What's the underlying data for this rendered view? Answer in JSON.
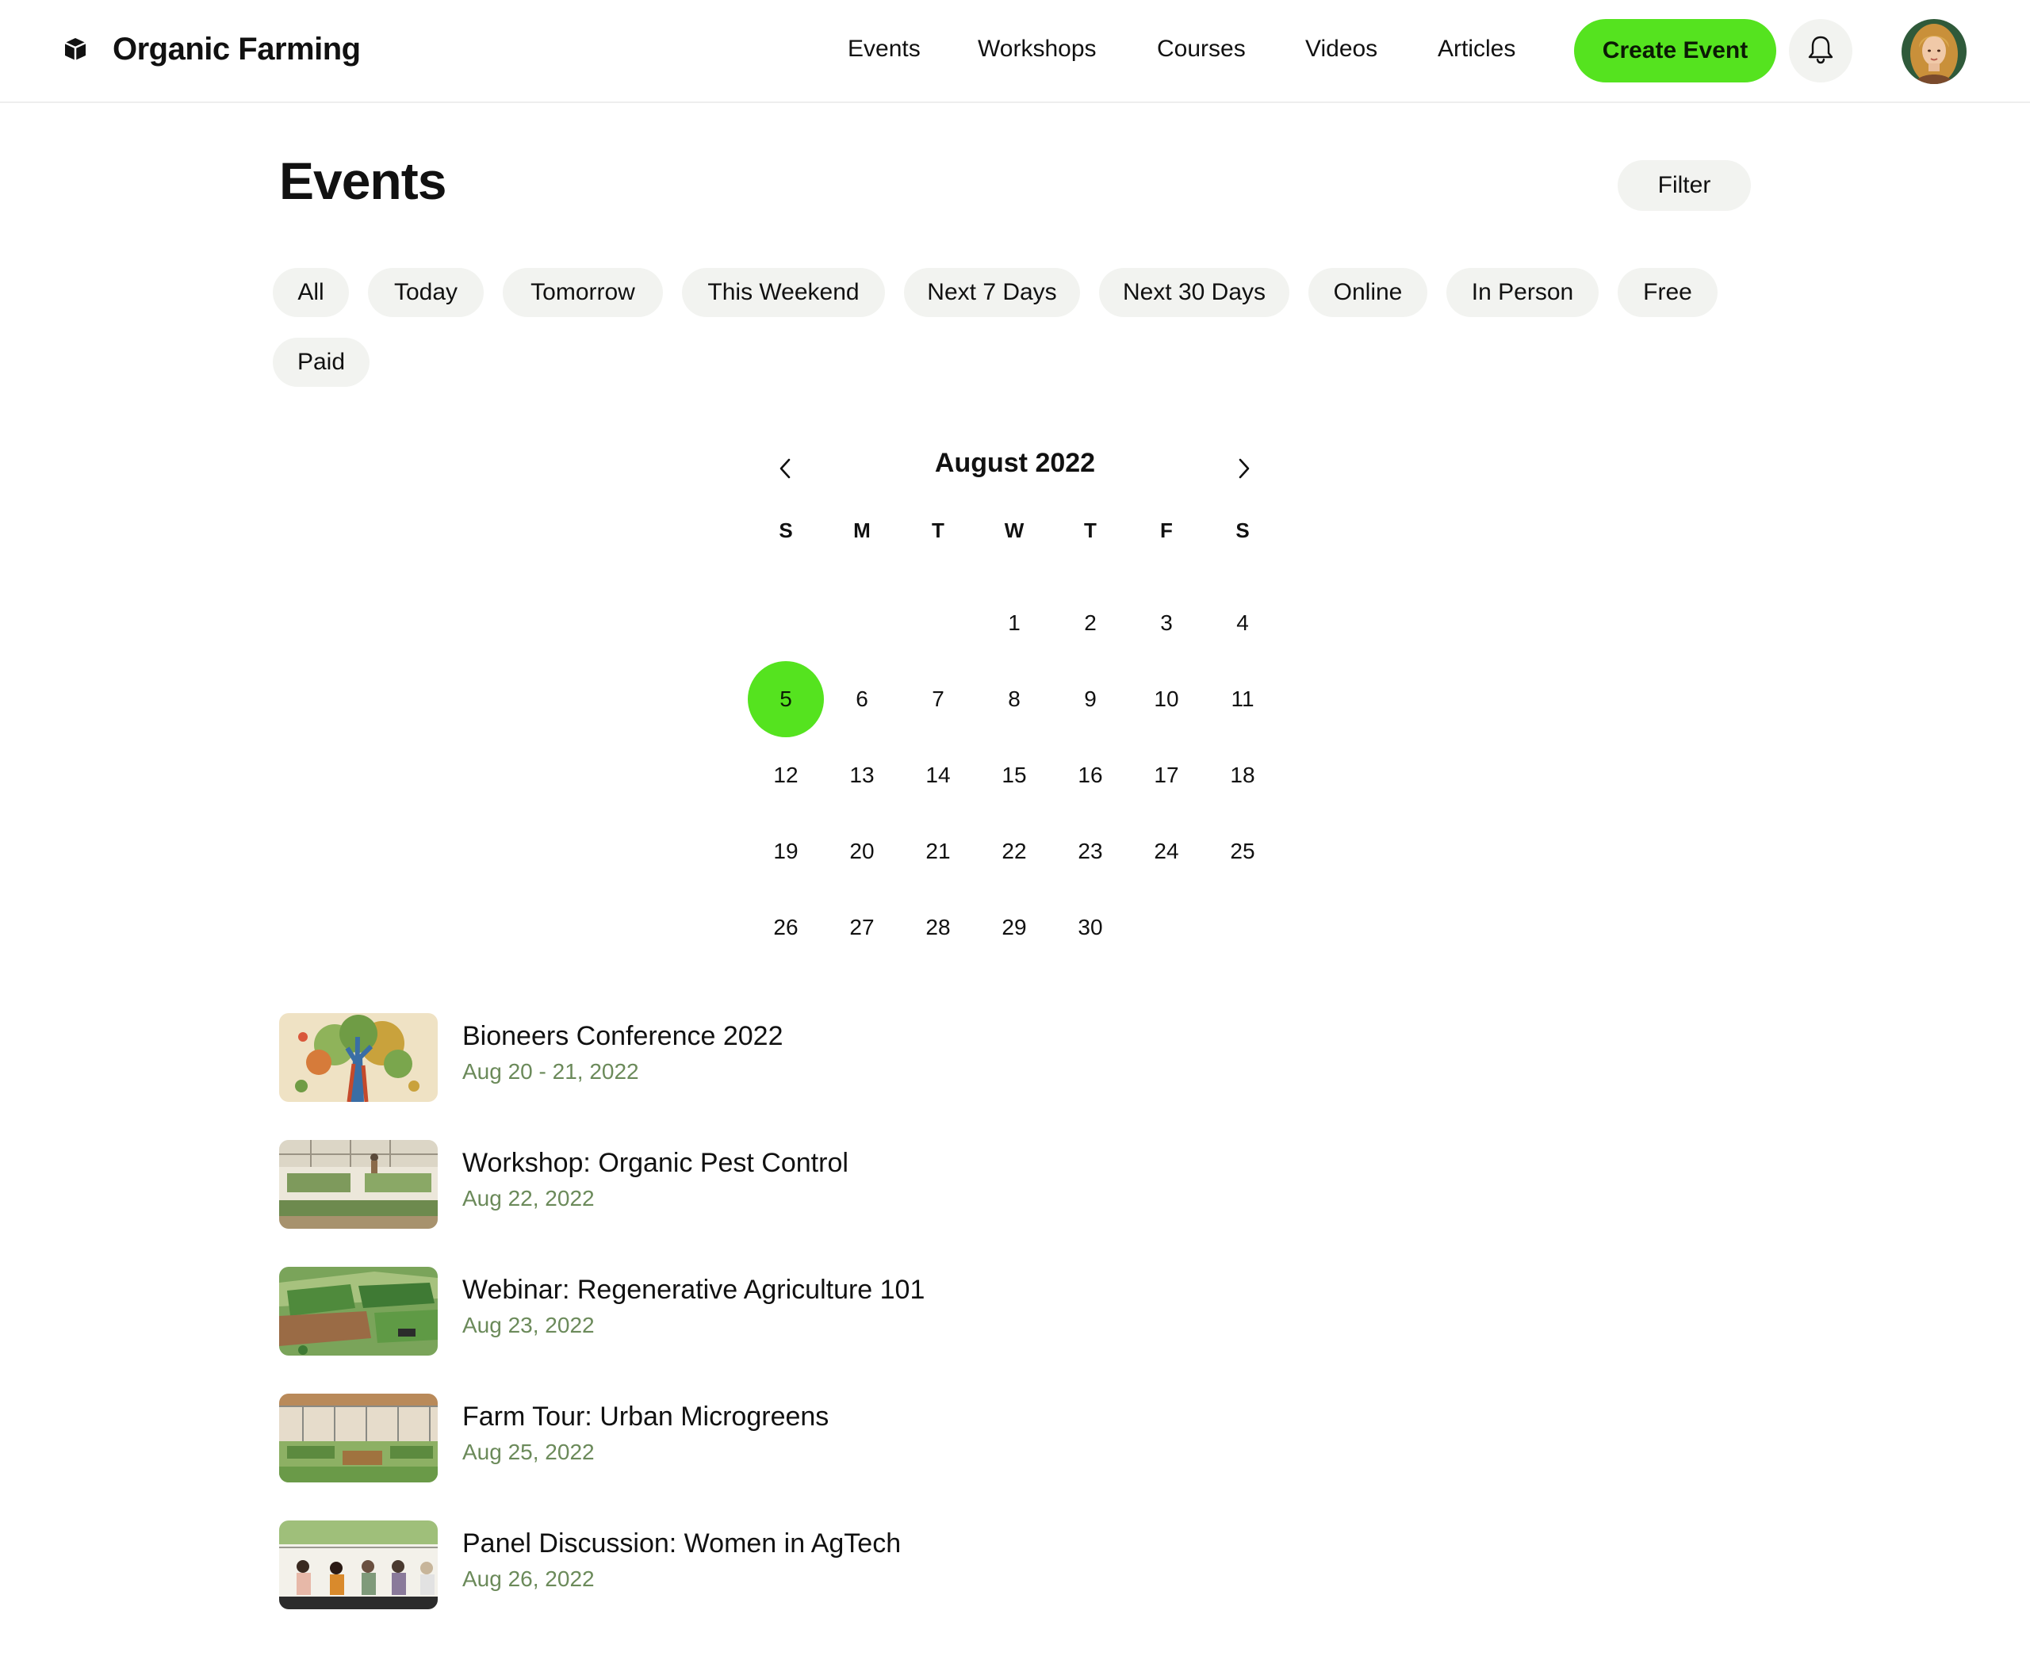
{
  "brand": {
    "name": "Organic Farming",
    "icon": "cube-icon"
  },
  "nav": {
    "links": [
      "Events",
      "Workshops",
      "Courses",
      "Videos",
      "Articles"
    ],
    "create_label": "Create Event",
    "bell_icon": "bell-icon"
  },
  "page": {
    "title": "Events",
    "filter_label": "Filter"
  },
  "chips": [
    "All",
    "Today",
    "Tomorrow",
    "This Weekend",
    "Next 7 Days",
    "Next 30 Days",
    "Online",
    "In Person",
    "Free",
    "Paid"
  ],
  "calendar": {
    "month_label": "August 2022",
    "weekdays": [
      "S",
      "M",
      "T",
      "W",
      "T",
      "F",
      "S"
    ],
    "first_weekday_index": 3,
    "days_in_month": 30,
    "selected_day": 5
  },
  "events": [
    {
      "title": "Bioneers Conference 2022",
      "date": "Aug 20 - 21, 2022"
    },
    {
      "title": "Workshop: Organic Pest Control",
      "date": "Aug 22, 2022"
    },
    {
      "title": "Webinar: Regenerative Agriculture 101",
      "date": "Aug 23, 2022"
    },
    {
      "title": "Farm Tour: Urban Microgreens",
      "date": "Aug 25, 2022"
    },
    {
      "title": "Panel Discussion: Women in AgTech",
      "date": "Aug 26, 2022"
    }
  ],
  "colors": {
    "accent": "#55e31f",
    "chip_bg": "#f2f3f0",
    "date_text": "#6b8a5a"
  }
}
